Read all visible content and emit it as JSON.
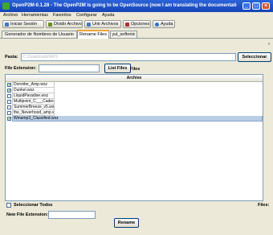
{
  "window": {
    "title": "OpenP2M-0.1.28 - The OpenP2M is going to be OpenSource (now I am translating the documentation , variab..."
  },
  "menu": [
    "Archivo",
    "Herramientas",
    "Favoritos",
    "Configurar",
    "Ayuda"
  ],
  "toolbar": [
    {
      "label": "Iniciar Sesión",
      "icon": "login-icon",
      "color": "#3c78c8"
    },
    {
      "label": "Dividir Archivo",
      "icon": "split-file-icon",
      "color": "#6b8e23"
    },
    {
      "label": "Unir Archivos",
      "icon": "join-files-icon",
      "color": "#4a7ab8"
    },
    {
      "label": "Opciones",
      "icon": "options-icon",
      "color": "#b03030"
    },
    {
      "label": "Ayuda",
      "icon": "help-icon",
      "color": "#2f6fd0"
    }
  ],
  "tabs": [
    "Generador de Nombres de Usuario",
    "Rename Files",
    "yul_softonic"
  ],
  "form": {
    "path_label": "Pasta:",
    "path_placeholder": "C:\\Downloads\\MP3",
    "select_button": "Seleccionar",
    "ext_label": "File Extension:",
    "ext_value": "",
    "list_button": "List Files"
  },
  "table": {
    "section_title": "Files",
    "column_header": "Archivo",
    "rows": [
      {
        "name": "Dorvider_Amp.wsz",
        "checked": true
      },
      {
        "name": "Dunkel.wsz",
        "checked": true
      },
      {
        "name": "LiquidParadise.wsz",
        "checked": false
      },
      {
        "name": "Multipoint_C___Cadecit.wsz",
        "checked": false
      },
      {
        "name": "SummerBreeze_v5.wsz",
        "checked": false
      },
      {
        "name": "the_Neverhood_amp.wsz",
        "checked": false
      },
      {
        "name": "Winamp3_Classified.wsz",
        "checked": true,
        "selected": true
      }
    ]
  },
  "footer": {
    "select_all_label": "Seleccionar Todos",
    "files_label": "Files:",
    "new_ext_label": "New File Extension:",
    "new_ext_value": "",
    "rename_button": "Rename"
  }
}
